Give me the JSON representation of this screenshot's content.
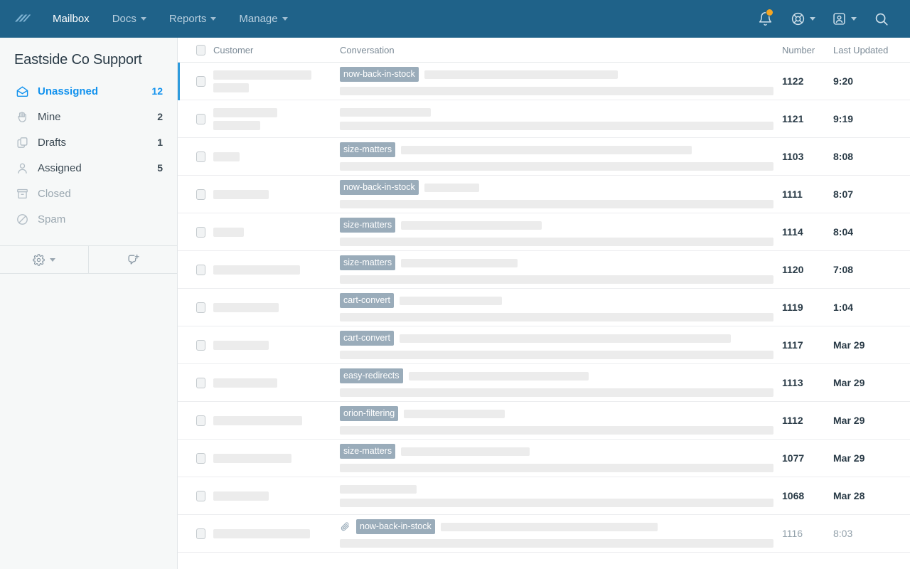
{
  "colors": {
    "nav_bg": "#1f6289",
    "accent_blue": "#1292ee",
    "selected_bar": "#2e9bdd",
    "tag_bg": "#9aacba",
    "badge": "#f5a623",
    "sidebar_bg": "#f6f8f8",
    "placeholder": "#ececec"
  },
  "topnav": {
    "logo": "helpscout-logo-icon",
    "brand": "Mailbox",
    "links": [
      {
        "label": "Docs",
        "caret": true
      },
      {
        "label": "Reports",
        "caret": true
      },
      {
        "label": "Manage",
        "caret": true
      }
    ],
    "icons": [
      {
        "name": "notifications-bell-icon",
        "badge": true
      },
      {
        "name": "help-lifebuoy-icon",
        "caret": true
      },
      {
        "name": "account-avatar-icon",
        "caret": true
      },
      {
        "name": "search-icon",
        "caret": false
      }
    ]
  },
  "sidebar": {
    "title": "Eastside Co Support",
    "folders": [
      {
        "label": "Unassigned",
        "count": "12",
        "icon": "open-envelope-icon",
        "state": "active"
      },
      {
        "label": "Mine",
        "count": "2",
        "icon": "raised-hand-icon",
        "state": "normal"
      },
      {
        "label": "Drafts",
        "count": "1",
        "icon": "copy-pages-icon",
        "state": "normal"
      },
      {
        "label": "Assigned",
        "count": "5",
        "icon": "person-icon",
        "state": "normal"
      },
      {
        "label": "Closed",
        "count": "",
        "icon": "archive-box-icon",
        "state": "muted"
      },
      {
        "label": "Spam",
        "count": "",
        "icon": "circle-slash-icon",
        "state": "muted"
      }
    ],
    "tools": [
      {
        "name": "mailbox-settings-gear-icon",
        "caret": true
      },
      {
        "name": "new-conversation-icon",
        "caret": false
      }
    ]
  },
  "table": {
    "headers": {
      "customer": "Customer",
      "conversation": "Conversation",
      "number": "Number",
      "last_updated": "Last Updated"
    },
    "rows": [
      {
        "number": "1122",
        "updated": "9:20",
        "tag": "now-back-in-stock",
        "attachment": false,
        "selected": true,
        "read": false,
        "cust": [
          138,
          50
        ],
        "conv": [
          272,
          610
        ]
      },
      {
        "number": "1121",
        "updated": "9:19",
        "tag": "",
        "attachment": false,
        "selected": false,
        "read": false,
        "cust": [
          90,
          66
        ],
        "conv": [
          128,
          610
        ]
      },
      {
        "number": "1103",
        "updated": "8:08",
        "tag": "size-matters",
        "attachment": false,
        "selected": false,
        "read": false,
        "cust": [
          37
        ],
        "conv": [
          409,
          610
        ]
      },
      {
        "number": "1111",
        "updated": "8:07",
        "tag": "now-back-in-stock",
        "attachment": false,
        "selected": false,
        "read": false,
        "cust": [
          78
        ],
        "conv": [
          77,
          610
        ]
      },
      {
        "number": "1114",
        "updated": "8:04",
        "tag": "size-matters",
        "attachment": false,
        "selected": false,
        "read": false,
        "cust": [
          43
        ],
        "conv": [
          198,
          610
        ]
      },
      {
        "number": "1120",
        "updated": "7:08",
        "tag": "size-matters",
        "attachment": false,
        "selected": false,
        "read": false,
        "cust": [
          122
        ],
        "conv": [
          164,
          610
        ]
      },
      {
        "number": "1119",
        "updated": "1:04",
        "tag": "cart-convert",
        "attachment": false,
        "selected": false,
        "read": false,
        "cust": [
          92
        ],
        "conv": [
          144,
          610
        ]
      },
      {
        "number": "1117",
        "updated": "Mar 29",
        "tag": "cart-convert",
        "attachment": false,
        "selected": false,
        "read": false,
        "cust": [
          78
        ],
        "conv": [
          466,
          610
        ]
      },
      {
        "number": "1113",
        "updated": "Mar 29",
        "tag": "easy-redirects",
        "attachment": false,
        "selected": false,
        "read": false,
        "cust": [
          90
        ],
        "conv": [
          253,
          610
        ]
      },
      {
        "number": "1112",
        "updated": "Mar 29",
        "tag": "orion-filtering",
        "attachment": false,
        "selected": false,
        "read": false,
        "cust": [
          125
        ],
        "conv": [
          142,
          610
        ]
      },
      {
        "number": "1077",
        "updated": "Mar 29",
        "tag": "size-matters",
        "attachment": false,
        "selected": false,
        "read": false,
        "cust": [
          110
        ],
        "conv": [
          181,
          610
        ]
      },
      {
        "number": "1068",
        "updated": "Mar 28",
        "tag": "",
        "attachment": false,
        "selected": false,
        "read": false,
        "cust": [
          78
        ],
        "conv": [
          108,
          610
        ]
      },
      {
        "number": "1116",
        "updated": "8:03",
        "tag": "now-back-in-stock",
        "attachment": true,
        "selected": false,
        "read": true,
        "cust": [
          136
        ],
        "conv": [
          305,
          610
        ]
      }
    ]
  }
}
